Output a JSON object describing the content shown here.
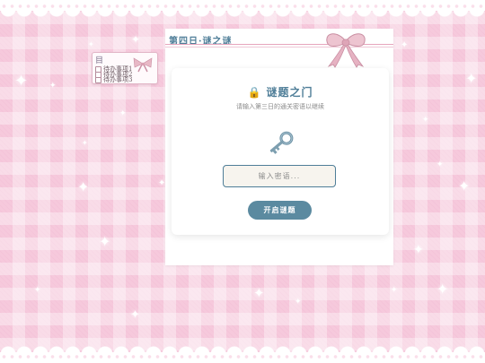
{
  "note": {
    "header": "目",
    "rows": [
      "待办事项1",
      "待办事项2",
      "待办事项3"
    ]
  },
  "panel": {
    "title": "第四日·谜之谜"
  },
  "card": {
    "title": "🔒 谜题之门",
    "subtitle": "请输入第三日的通关密语以继续",
    "input_placeholder": "输入密语...",
    "input_value": "",
    "button_label": "开启谜题"
  },
  "colors": {
    "accent": "#4f7e98",
    "button": "#5b8aa0",
    "background": "#f6c9dc",
    "ribbon": "#e8b8c6"
  },
  "icons": [
    "key-icon",
    "lock-icon",
    "ribbon-bow-icon",
    "sparkle-icon"
  ]
}
